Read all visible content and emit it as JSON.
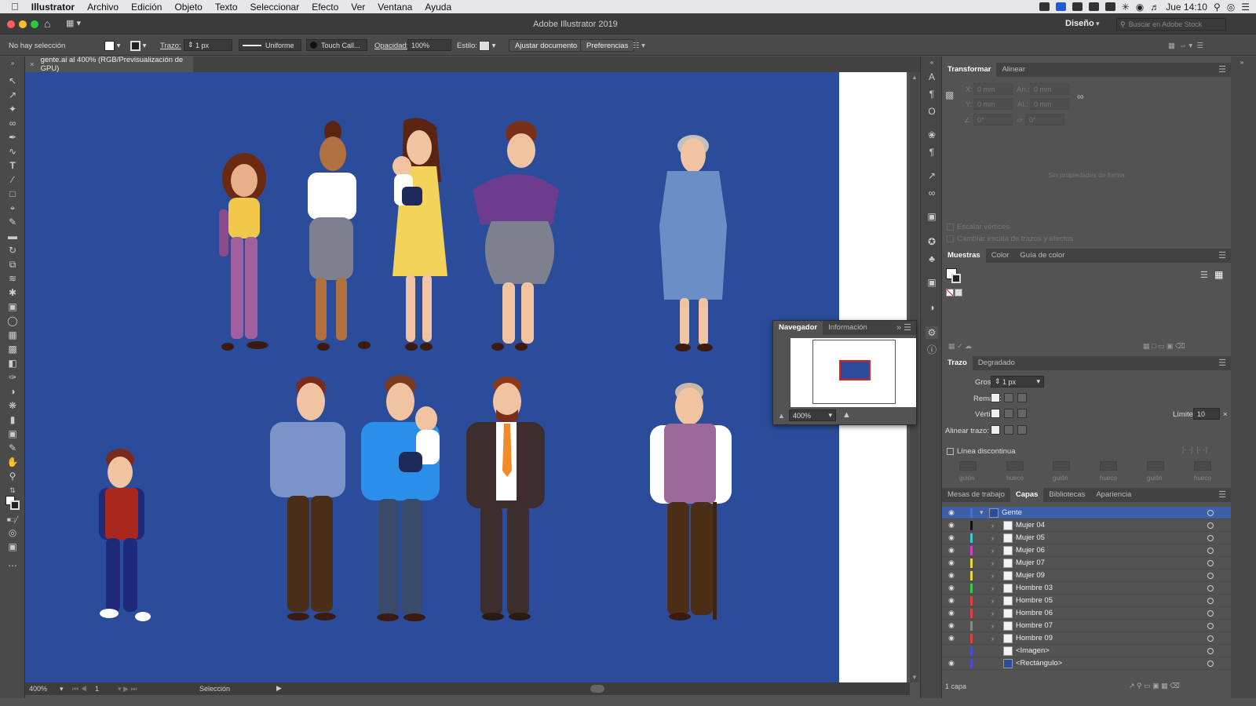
{
  "menubar": {
    "app": "Illustrator",
    "items": [
      "Archivo",
      "Edición",
      "Objeto",
      "Texto",
      "Seleccionar",
      "Efecto",
      "Ver",
      "Ventana",
      "Ayuda"
    ],
    "clock": "Jue 14:10"
  },
  "titlebar": {
    "title": "Adobe Illustrator 2019",
    "workspace": "Diseño",
    "search_placeholder": "Buscar en Adobe Stock"
  },
  "control": {
    "selection": "No hay selección",
    "stroke_label": "Trazo:",
    "stroke_value": "1 px",
    "profile": "Uniforme",
    "brush": "Touch Call...",
    "opacity_label": "Opacidad:",
    "opacity_value": "100%",
    "style_label": "Estilo:",
    "fit_button": "Ajustar documento",
    "prefs_button": "Preferencias"
  },
  "document": {
    "tab": "gente.ai al 400% (RGB/Previsualización de GPU)"
  },
  "status": {
    "zoom": "400%",
    "artboard": "1",
    "tool": "Selección"
  },
  "navigator": {
    "tabs": [
      "Navegador",
      "Información"
    ],
    "zoom": "400%"
  },
  "transform": {
    "tabs": [
      "Transformar",
      "Alinear"
    ],
    "x_label": "X:",
    "x_value": "0 mm",
    "w_label": "An.:",
    "w_value": "0 mm",
    "y_label": "Y:",
    "y_value": "0 mm",
    "h_label": "Al.:",
    "h_value": "0 mm",
    "angle_value": "0°",
    "shear_value": "0°",
    "no_props": "Sin propiedades de forma",
    "scale_corners": "Escalar vértices",
    "scale_strokes": "Cambiar escala de trazos y efectos"
  },
  "swatches": {
    "tabs": [
      "Muestras",
      "Color",
      "Guía de color"
    ]
  },
  "stroke": {
    "tabs": [
      "Trazo",
      "Degradado"
    ],
    "weight_label": "Grosor:",
    "weight_value": "1 px",
    "cap_label": "Remate:",
    "corner_label": "Vértice:",
    "limit_label": "Límite:",
    "limit_value": "10",
    "align_label": "Alinear trazo:",
    "dashed": "Línea discontinua",
    "dash_labels": [
      "guión",
      "hueco",
      "guión",
      "hueco",
      "guión",
      "hueco"
    ]
  },
  "layers": {
    "tabs": [
      "Mesas de trabajo",
      "Capas",
      "Bibliotecas",
      "Apariencia"
    ],
    "count": "1 capa",
    "items": [
      {
        "name": "Gente",
        "color": "#4b6bd6"
      },
      {
        "name": "Mujer 04",
        "color": "#111111"
      },
      {
        "name": "Mujer 05",
        "color": "#3ec8d0"
      },
      {
        "name": "Mujer 06",
        "color": "#d040c0"
      },
      {
        "name": "Mujer 07",
        "color": "#e8d83a"
      },
      {
        "name": "Mujer 09",
        "color": "#e8d83a"
      },
      {
        "name": "Hombre 03",
        "color": "#3ec84a"
      },
      {
        "name": "Hombre 05",
        "color": "#e04040"
      },
      {
        "name": "Hombre 06",
        "color": "#e04040"
      },
      {
        "name": "Hombre 07",
        "color": "#888888"
      },
      {
        "name": "Hombre 09",
        "color": "#e04040"
      },
      {
        "name": "<Imagen>",
        "color": "#4b4bd6"
      },
      {
        "name": "<Rectángulo>",
        "color": "#4b4bd6"
      }
    ]
  }
}
